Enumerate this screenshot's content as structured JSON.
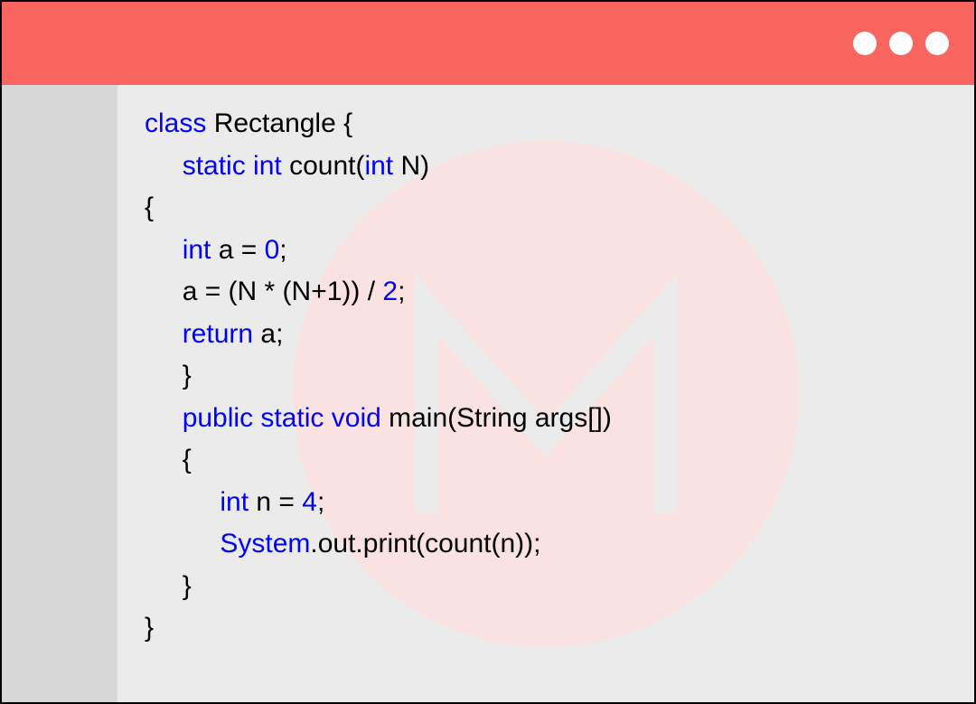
{
  "titlebar": {
    "dots": 3
  },
  "watermark": {
    "letter": "M"
  },
  "code": {
    "lines": [
      {
        "indent": 0,
        "tokens": [
          {
            "t": "class",
            "c": "kw"
          },
          {
            "t": " Rectangle {",
            "c": ""
          }
        ]
      },
      {
        "indent": 1,
        "tokens": [
          {
            "t": "static int",
            "c": "kw"
          },
          {
            "t": " count(",
            "c": ""
          },
          {
            "t": "int",
            "c": "kw"
          },
          {
            "t": " N)",
            "c": ""
          }
        ]
      },
      {
        "indent": 0,
        "tokens": [
          {
            "t": "{",
            "c": ""
          }
        ]
      },
      {
        "indent": 1,
        "tokens": [
          {
            "t": "int",
            "c": "kw"
          },
          {
            "t": " a = ",
            "c": ""
          },
          {
            "t": "0",
            "c": "kw"
          },
          {
            "t": ";",
            "c": ""
          }
        ]
      },
      {
        "indent": 1,
        "tokens": [
          {
            "t": "a = (N * (N+1)) / ",
            "c": ""
          },
          {
            "t": "2",
            "c": "kw"
          },
          {
            "t": ";",
            "c": ""
          }
        ]
      },
      {
        "indent": 1,
        "tokens": [
          {
            "t": "return",
            "c": "kw"
          },
          {
            "t": " a;",
            "c": ""
          }
        ]
      },
      {
        "indent": 1,
        "tokens": [
          {
            "t": "}",
            "c": ""
          }
        ]
      },
      {
        "indent": 1,
        "tokens": [
          {
            "t": "public static void",
            "c": "kw"
          },
          {
            "t": " main(String args[])",
            "c": ""
          }
        ]
      },
      {
        "indent": 1,
        "tokens": [
          {
            "t": "{",
            "c": ""
          }
        ]
      },
      {
        "indent": 2,
        "tokens": [
          {
            "t": "int",
            "c": "kw"
          },
          {
            "t": " n = ",
            "c": ""
          },
          {
            "t": "4",
            "c": "kw"
          },
          {
            "t": ";",
            "c": ""
          }
        ]
      },
      {
        "indent": 2,
        "tokens": [
          {
            "t": "System",
            "c": "kw"
          },
          {
            "t": ".out.print(count(n));",
            "c": ""
          }
        ]
      },
      {
        "indent": 1,
        "tokens": [
          {
            "t": "}",
            "c": ""
          }
        ]
      },
      {
        "indent": 0,
        "tokens": [
          {
            "t": "}",
            "c": ""
          }
        ]
      }
    ]
  }
}
